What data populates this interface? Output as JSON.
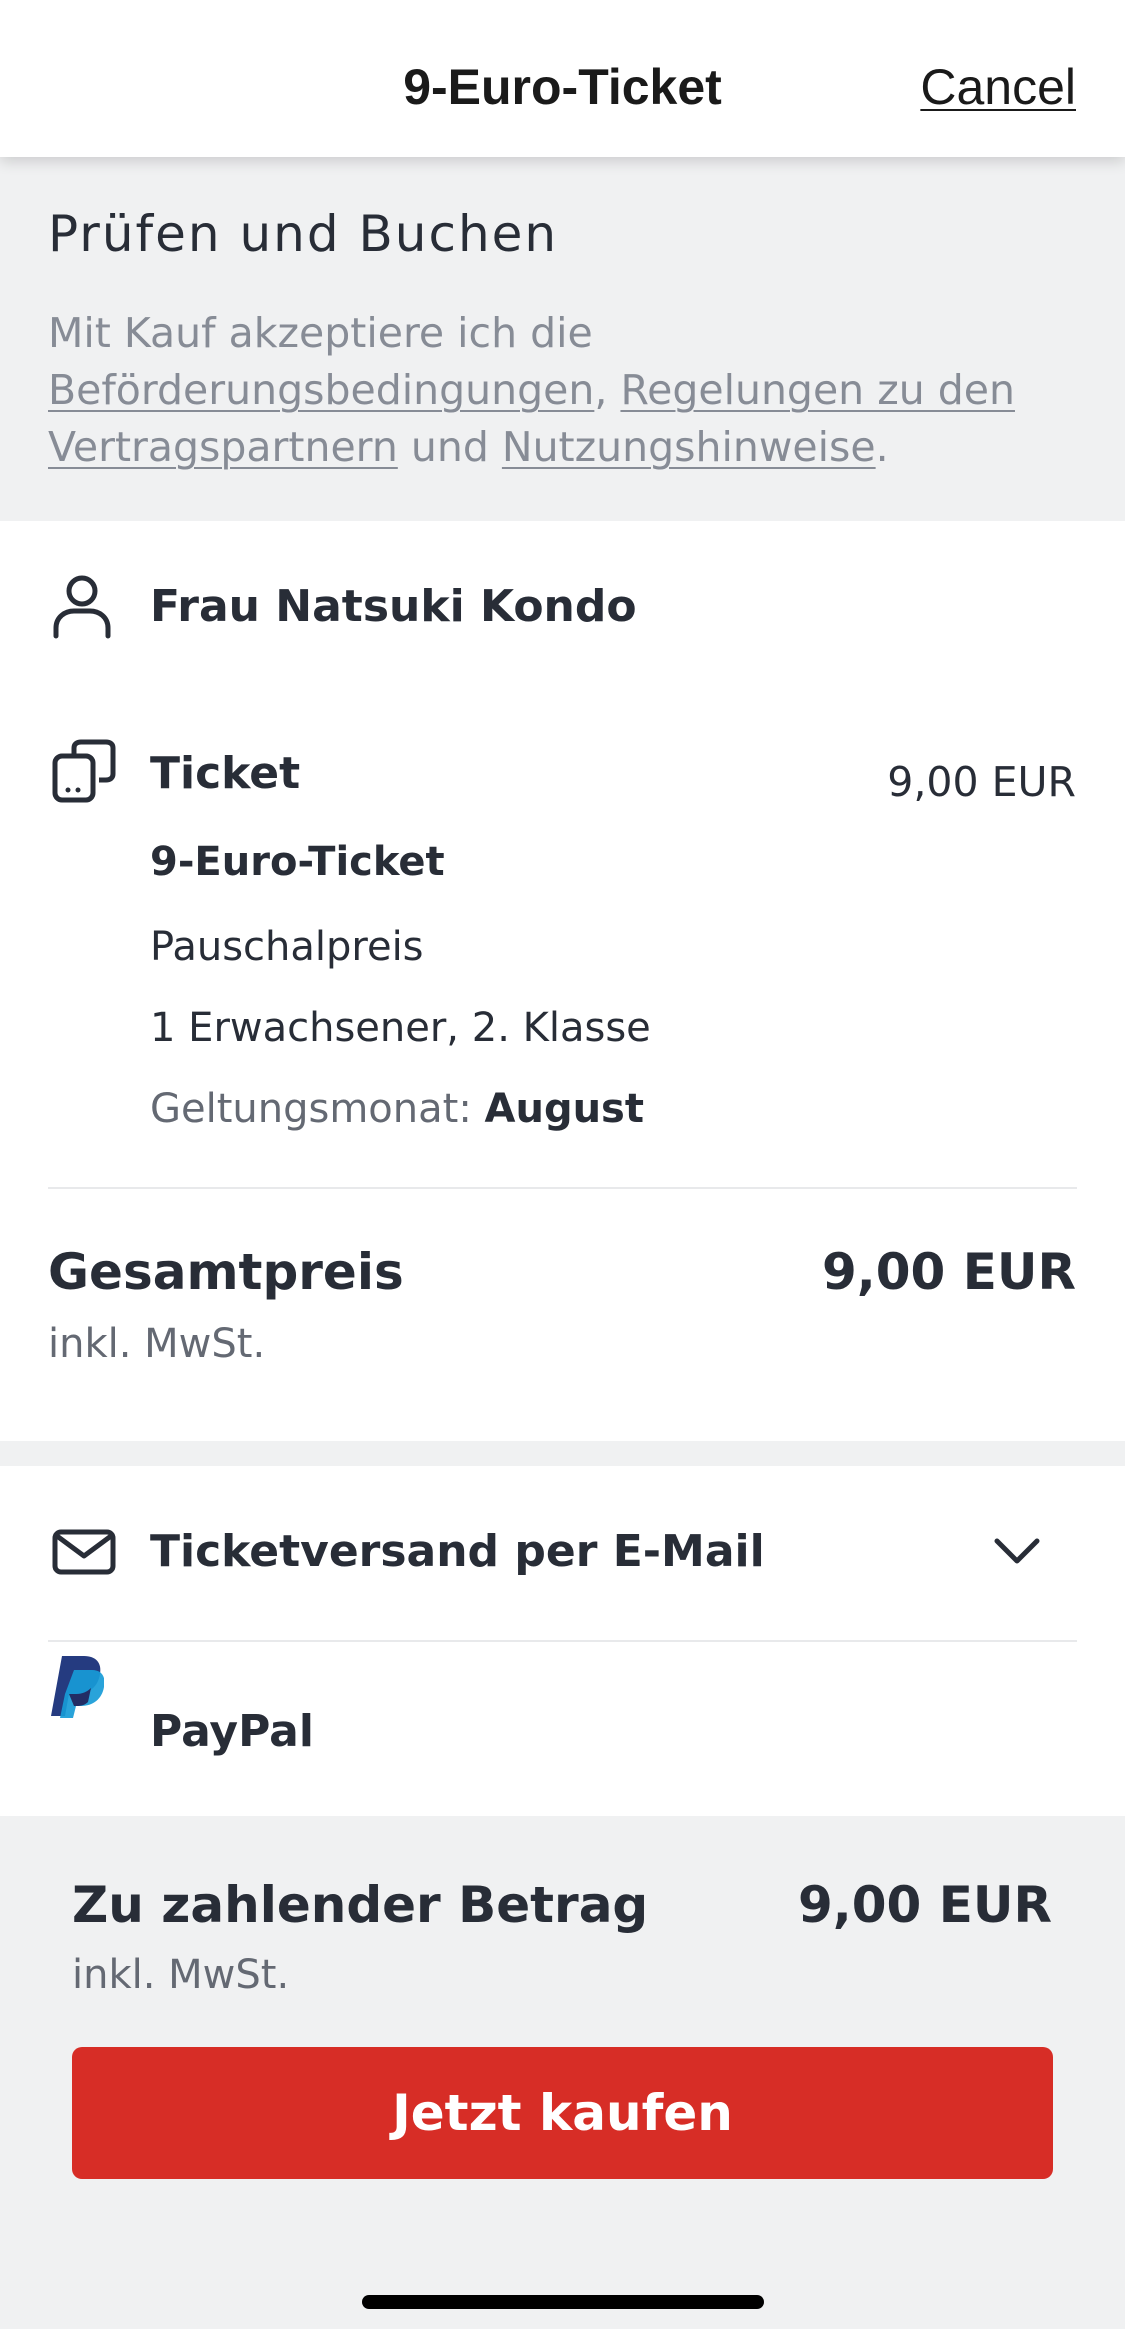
{
  "header": {
    "title": "9-Euro-Ticket",
    "cancel_label": "Cancel"
  },
  "review": {
    "heading": "Prüfen und Buchen",
    "terms_prefix": "Mit Kauf akzeptiere ich die",
    "link_conditions": "Beförderungsbedingungen",
    "sep_comma": ",",
    "link_partners": "Regelungen zu den Vertragspartnern",
    "word_and": "und",
    "link_usage": "Nutzungshinweise",
    "terms_end": "."
  },
  "passenger": {
    "name": "Frau Natsuki Kondo",
    "icon": "person-icon"
  },
  "ticket": {
    "icon": "devices-icon",
    "label": "Ticket",
    "price": "9,00 EUR",
    "name": "9-Euro-Ticket",
    "fare": "Pauschalpreis",
    "passengers": "1 Erwachsener, 2. Klasse",
    "validity_label": "Geltungsmonat:",
    "validity_value": "August"
  },
  "total": {
    "label": "Gesamtpreis",
    "price": "9,00 EUR",
    "vat": "inkl. MwSt."
  },
  "delivery": {
    "icon": "mail-icon",
    "label": "Ticketversand per E-Mail"
  },
  "payment": {
    "icon": "paypal-icon",
    "label": "PayPal"
  },
  "footer": {
    "pay_label": "Zu zahlender Betrag",
    "pay_amount": "9,00 EUR",
    "vat": "inkl. MwSt.",
    "buy_label": "Jetzt kaufen"
  },
  "colors": {
    "accent_red": "#d72d26",
    "text": "#282d37",
    "muted": "#878c96",
    "background": "#f0f1f2",
    "paypal_dark": "#253b80",
    "paypal_light": "#179bd7"
  }
}
